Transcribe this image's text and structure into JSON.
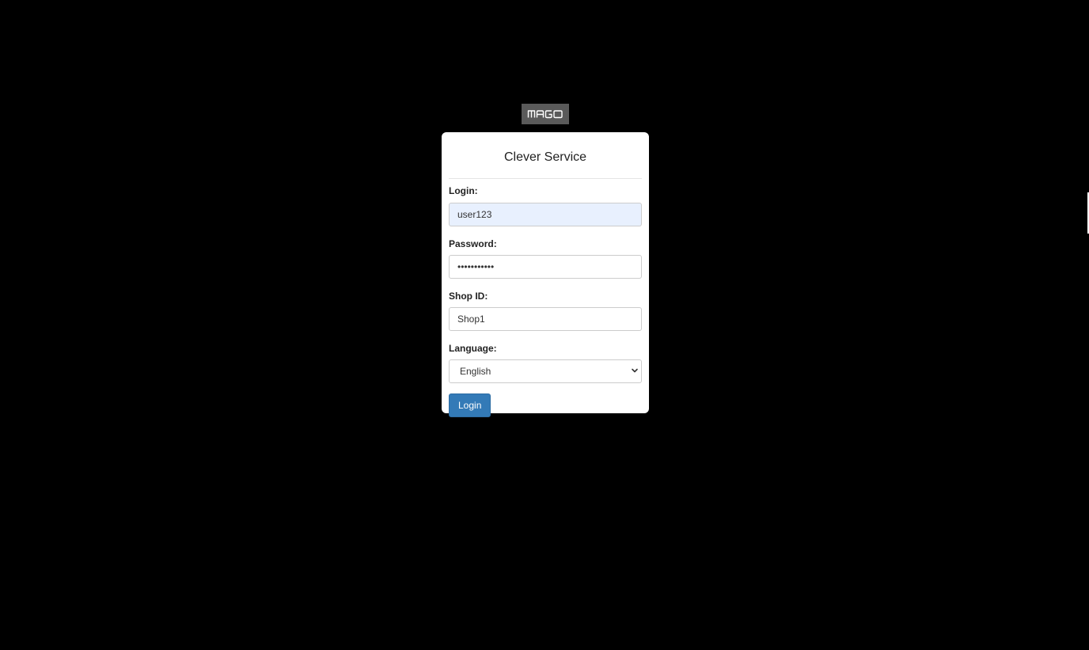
{
  "logo": {
    "text": "MAGO",
    "background": "#5a5a5a"
  },
  "form": {
    "title": "Clever Service",
    "login": {
      "label": "Login:",
      "value": "user123"
    },
    "password": {
      "label": "Password:",
      "value": "•••••••••••"
    },
    "shop": {
      "label": "Shop ID:",
      "value": "Shop1"
    },
    "language": {
      "label": "Language:",
      "selected": "English"
    },
    "submit_label": "Login"
  },
  "colors": {
    "background": "#000000",
    "card": "#ffffff",
    "primary": "#337ab7",
    "autofill": "#e8f0fe"
  },
  "icons": {
    "select_arrow": "chevron-down-icon"
  }
}
